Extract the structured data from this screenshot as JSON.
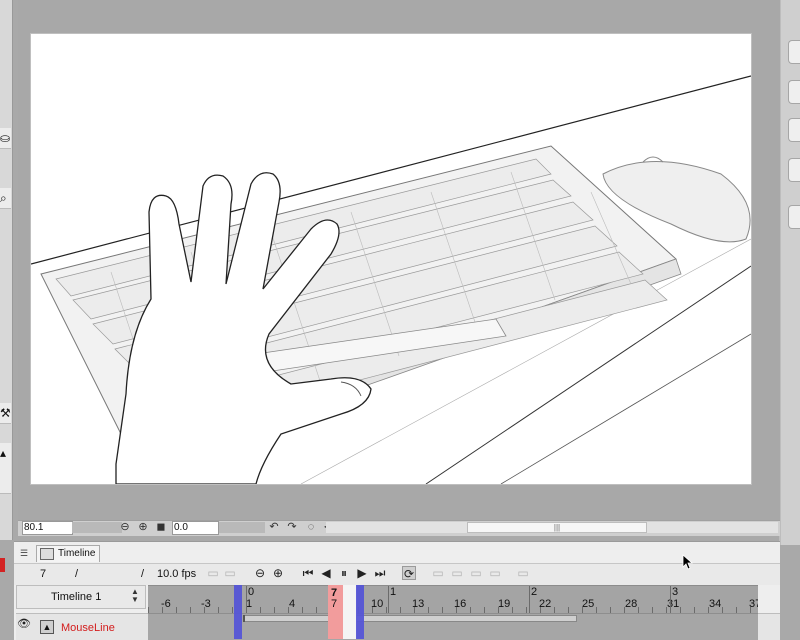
{
  "status": {
    "zoom": "80.1",
    "angle": "0.0",
    "icons": [
      "zoom-out-icon",
      "zoom-in-icon",
      "fit-icon",
      "rotate-left-icon",
      "rotate-right-icon",
      "reset-rotation-icon",
      "scroll-left-icon"
    ]
  },
  "timeline": {
    "tab_label": "Timeline",
    "current_frame": "7",
    "slash_left": "/",
    "slash_right": "/",
    "fps": "10.0 fps",
    "name": "Timeline 1",
    "ruler_top": [
      "0",
      "1",
      "2",
      "3"
    ],
    "ruler_bottom": [
      "-6",
      "-3",
      "1",
      "4",
      "7",
      "10",
      "13",
      "16",
      "19",
      "22",
      "25",
      "28",
      "31",
      "34",
      "37"
    ],
    "marker_frame_top": "7",
    "marker_frame_bottom": "7"
  },
  "layer": {
    "name": "MouseLine",
    "color": "#d31c1c"
  },
  "colors": {
    "marker_blue": "#5555d6",
    "marker_red": "#f29c9c",
    "canvas_bg": "#a8a8a8"
  }
}
